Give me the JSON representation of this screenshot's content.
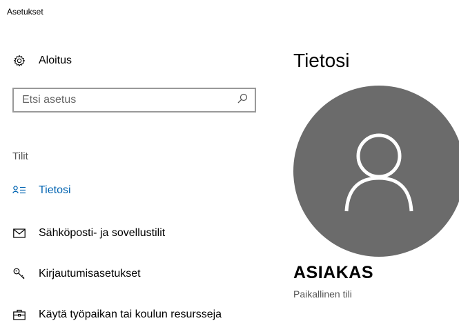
{
  "window": {
    "title": "Asetukset"
  },
  "sidebar": {
    "home_label": "Aloitus",
    "search_placeholder": "Etsi asetus",
    "section_title": "Tilit",
    "items": [
      {
        "label": "Tietosi",
        "icon": "person-list-icon",
        "active": true
      },
      {
        "label": "Sähköposti- ja sovellustilit",
        "icon": "mail-icon",
        "active": false
      },
      {
        "label": "Kirjautumisasetukset",
        "icon": "key-icon",
        "active": false
      },
      {
        "label": "Käytä työpaikan tai koulun resursseja",
        "icon": "briefcase-icon",
        "active": false
      }
    ]
  },
  "main": {
    "title": "Tietosi",
    "user_name": "ASIAKAS",
    "account_type": "Paikallinen tili"
  },
  "colors": {
    "accent": "#0063b1",
    "avatar_bg": "#6b6b6b",
    "search_border": "#999999"
  }
}
